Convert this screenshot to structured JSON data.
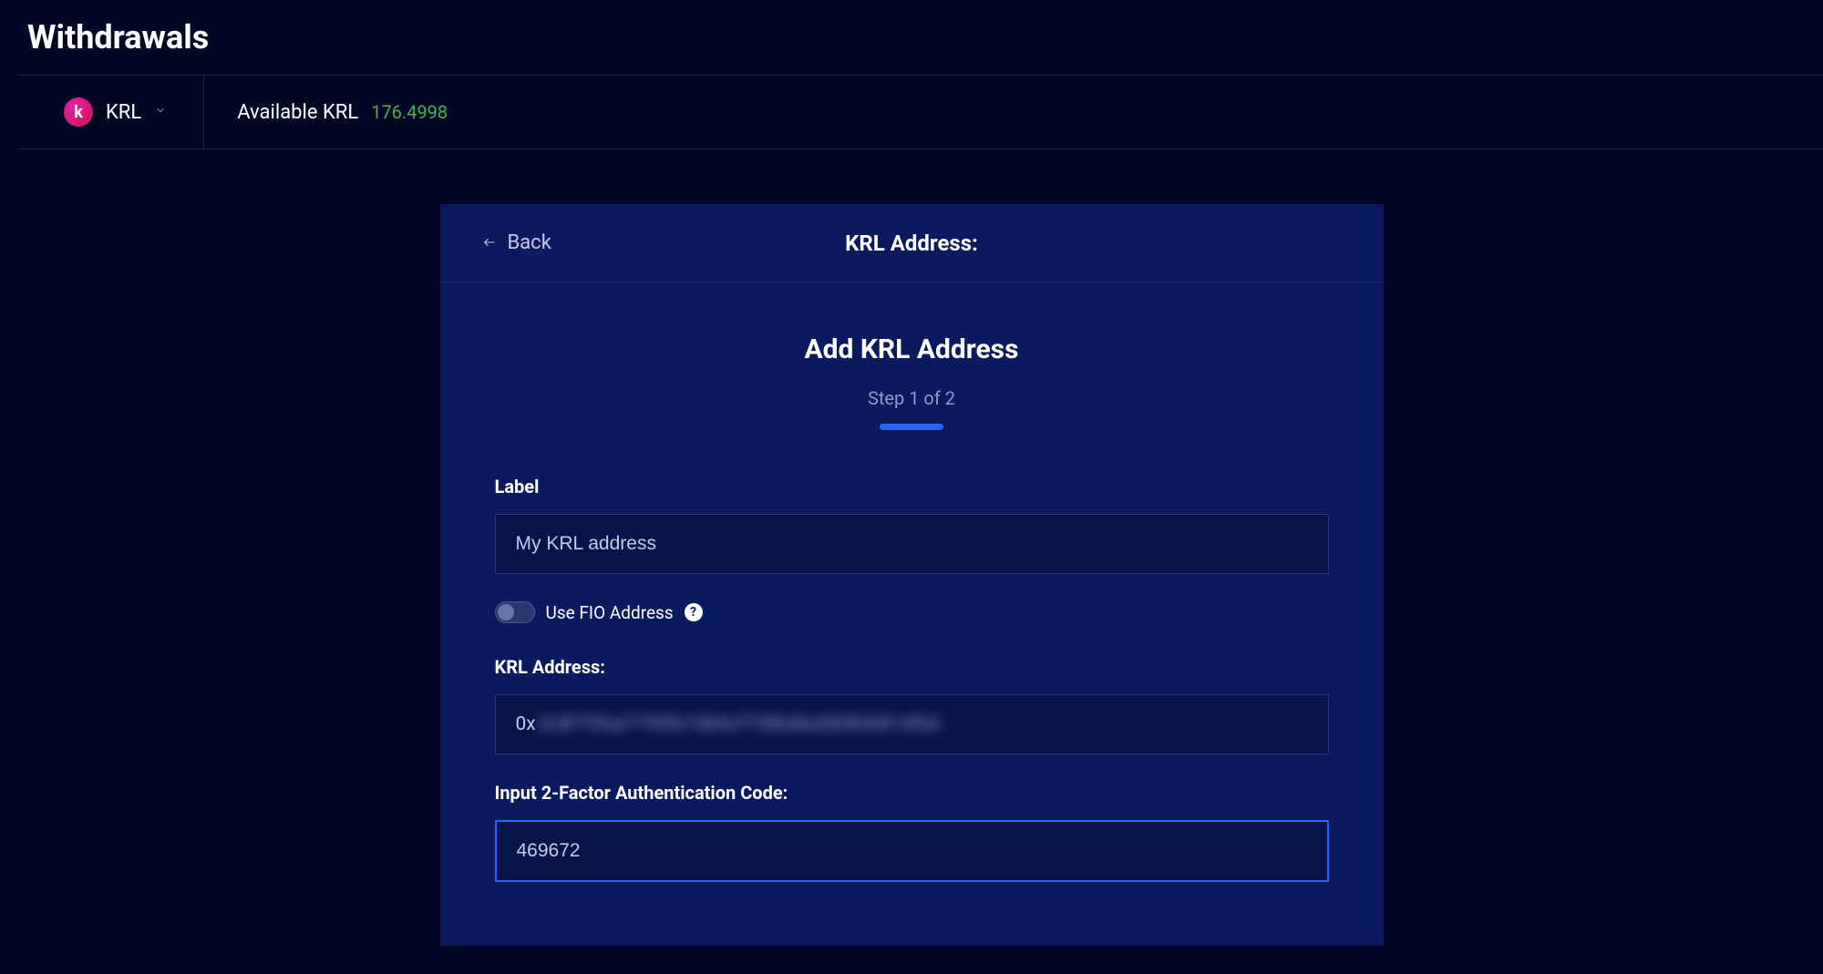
{
  "page": {
    "title": "Withdrawals"
  },
  "header": {
    "coin_symbol": "KRL",
    "coin_icon_letter": "k",
    "available_label": "Available KRL",
    "available_amount": "176.4998"
  },
  "panel": {
    "back_label": "Back",
    "header_title": "KRL Address:",
    "form_title": "Add KRL Address",
    "step_text": "Step 1 of 2"
  },
  "form": {
    "label_field": {
      "label": "Label",
      "value": "My KRL address"
    },
    "fio_toggle": {
      "label": "Use FIO Address",
      "enabled": false
    },
    "address_field": {
      "label": "KRL Address:",
      "prefix": "0x",
      "value_redacted": "3c8f79faa7795fe10b9cf7386d6a56f843814f6d"
    },
    "twofa_field": {
      "label": "Input 2-Factor Authentication Code:",
      "value": "469672"
    }
  }
}
